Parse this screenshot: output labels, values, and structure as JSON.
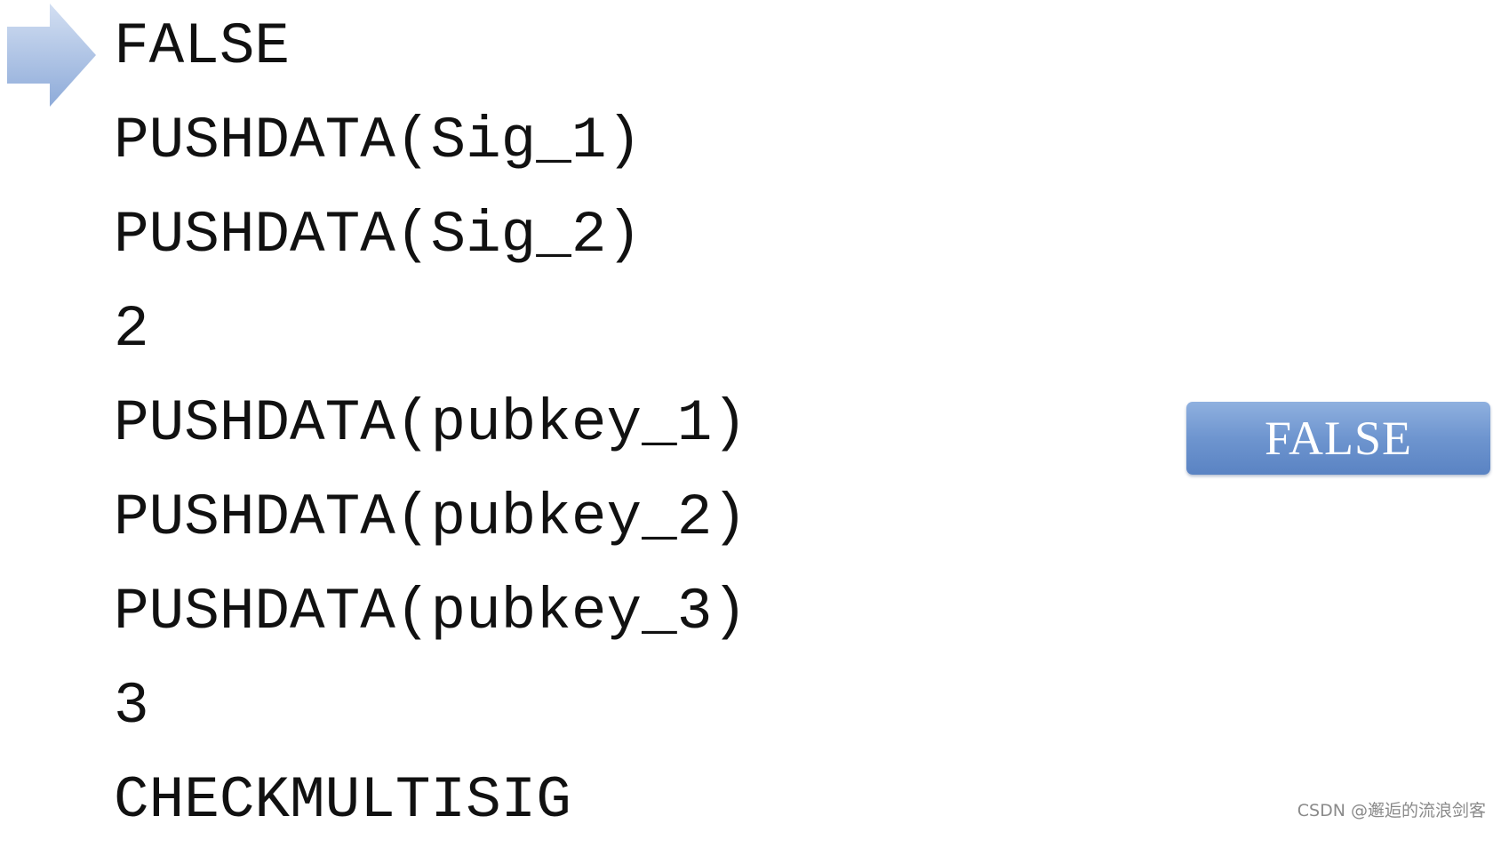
{
  "script_lines": [
    "FALSE",
    "PUSHDATA(Sig_1)",
    "PUSHDATA(Sig_2)",
    "2",
    "PUSHDATA(pubkey_1)",
    "PUSHDATA(pubkey_2)",
    "PUSHDATA(pubkey_3)",
    "3",
    "CHECKMULTISIG"
  ],
  "current_line": 0,
  "stack": [
    "FALSE"
  ],
  "watermark": "CSDN @邂逅的流浪剑客",
  "colors": {
    "arrow_light": "#cfdcf0",
    "arrow_dark": "#8eabd9",
    "stack_item": "#6e95cf",
    "text": "#111111"
  }
}
